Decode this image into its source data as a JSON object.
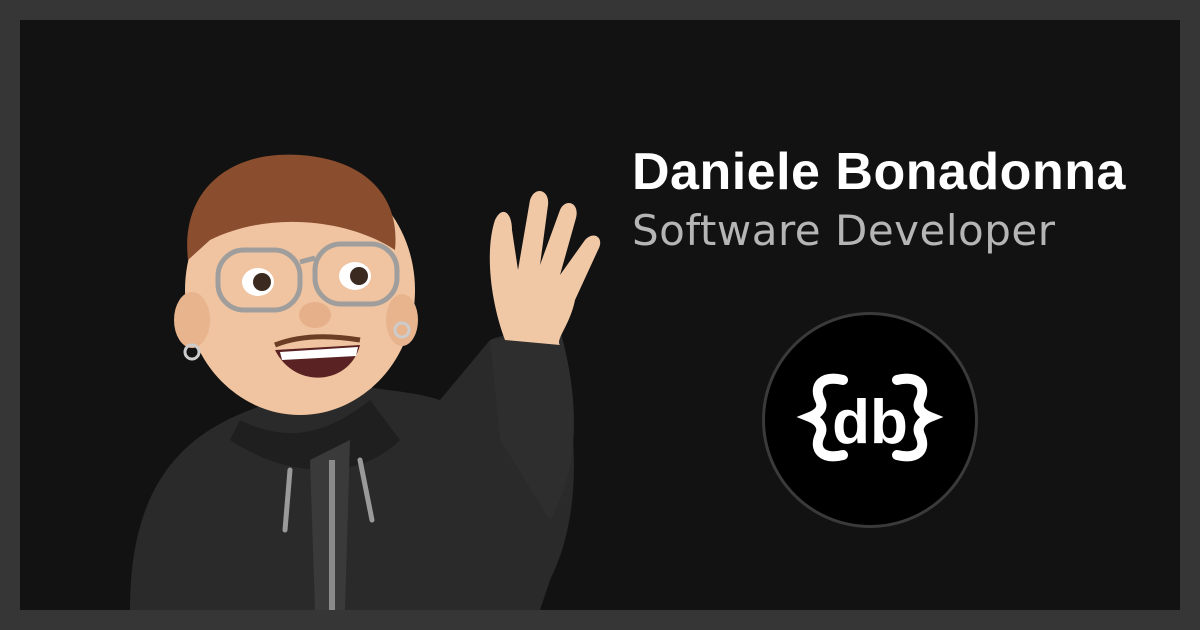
{
  "profile": {
    "name": "Daniele Bonadonna",
    "role": "Software Developer"
  },
  "logo": {
    "text": "db",
    "icon": "curly-braces-db-logo"
  },
  "avatar": {
    "icon": "waving-memoji-avatar"
  },
  "colors": {
    "frame": "#363636",
    "background": "#121212",
    "name": "#ffffff",
    "role": "#b5b5b5",
    "logo_ring": "#3a3a3a"
  }
}
